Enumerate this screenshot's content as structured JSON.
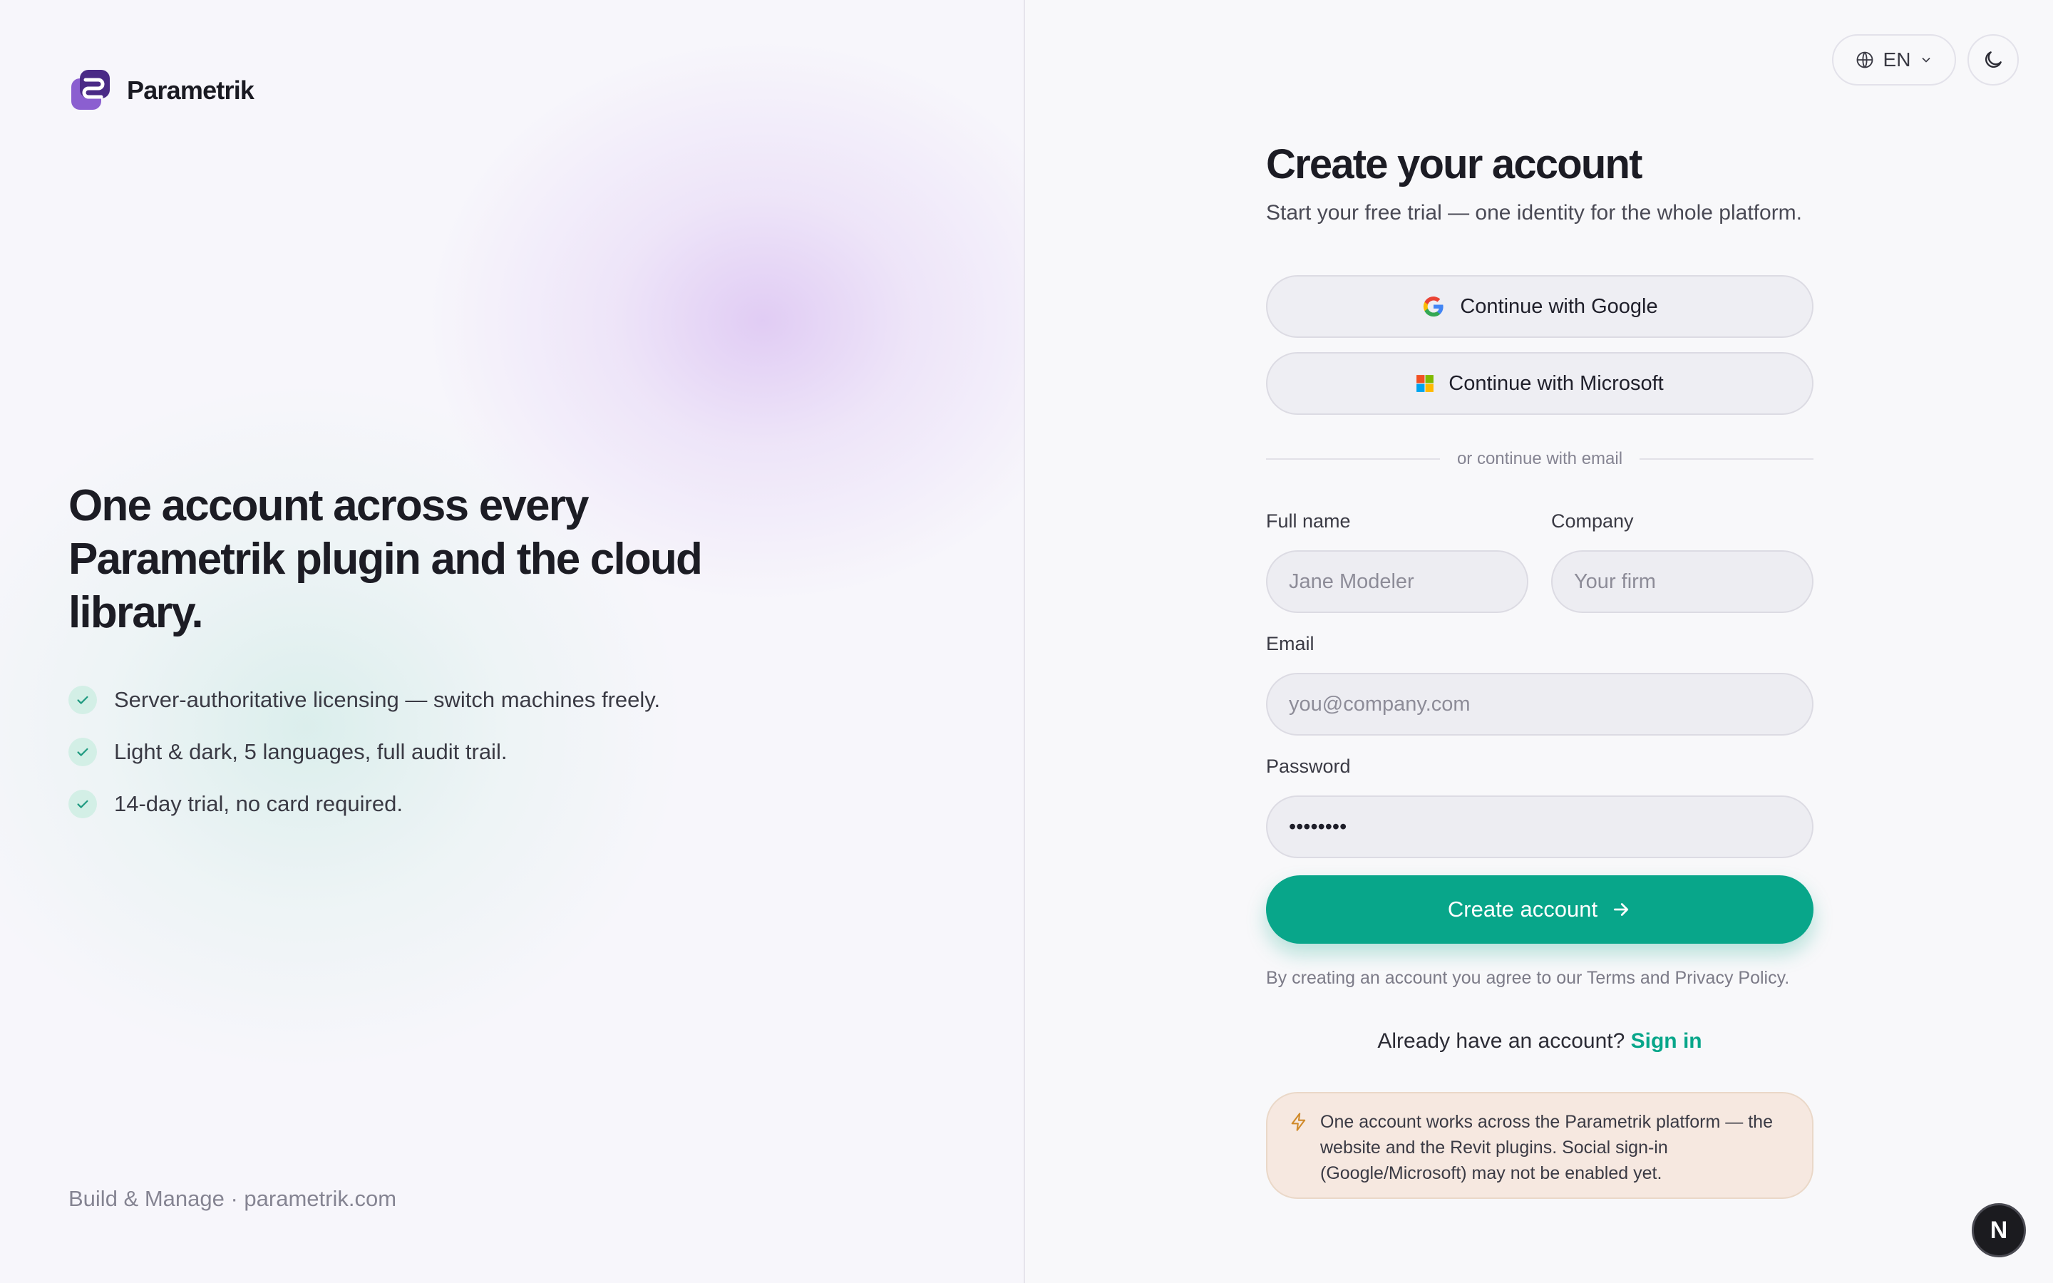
{
  "brand": {
    "name": "Parametrik"
  },
  "hero": {
    "title": "One account across every Parametrik plugin and the cloud library.",
    "features": [
      "Server-authoritative licensing — switch machines freely.",
      "Light & dark, 5 languages, full audit trail.",
      "14-day trial, no card required."
    ],
    "footer": "Build & Manage · parametrik.com"
  },
  "topbar": {
    "language": "EN"
  },
  "form": {
    "title": "Create your account",
    "subtitle": "Start your free trial — one identity for the whole platform.",
    "google_label": "Continue with Google",
    "microsoft_label": "Continue with Microsoft",
    "divider": "or continue with email",
    "full_name": {
      "label": "Full name",
      "placeholder": "Jane Modeler"
    },
    "company": {
      "label": "Company",
      "placeholder": "Your firm"
    },
    "email": {
      "label": "Email",
      "placeholder": "you@company.com"
    },
    "password": {
      "label": "Password",
      "value": "••••••••"
    },
    "submit_label": "Create account",
    "terms": "By creating an account you agree to our Terms and Privacy Policy.",
    "signin_prompt": "Already have an account?",
    "signin_link": "Sign in",
    "notice": "One account works across the Parametrik platform — the website and the Revit plugins. Social sign-in (Google/Microsoft) may not be enabled yet."
  },
  "badge": {
    "letter": "N"
  },
  "colors": {
    "accent": "#08a68a",
    "logo": "#6a3fb0",
    "notice_bg": "#f6e8e0"
  }
}
